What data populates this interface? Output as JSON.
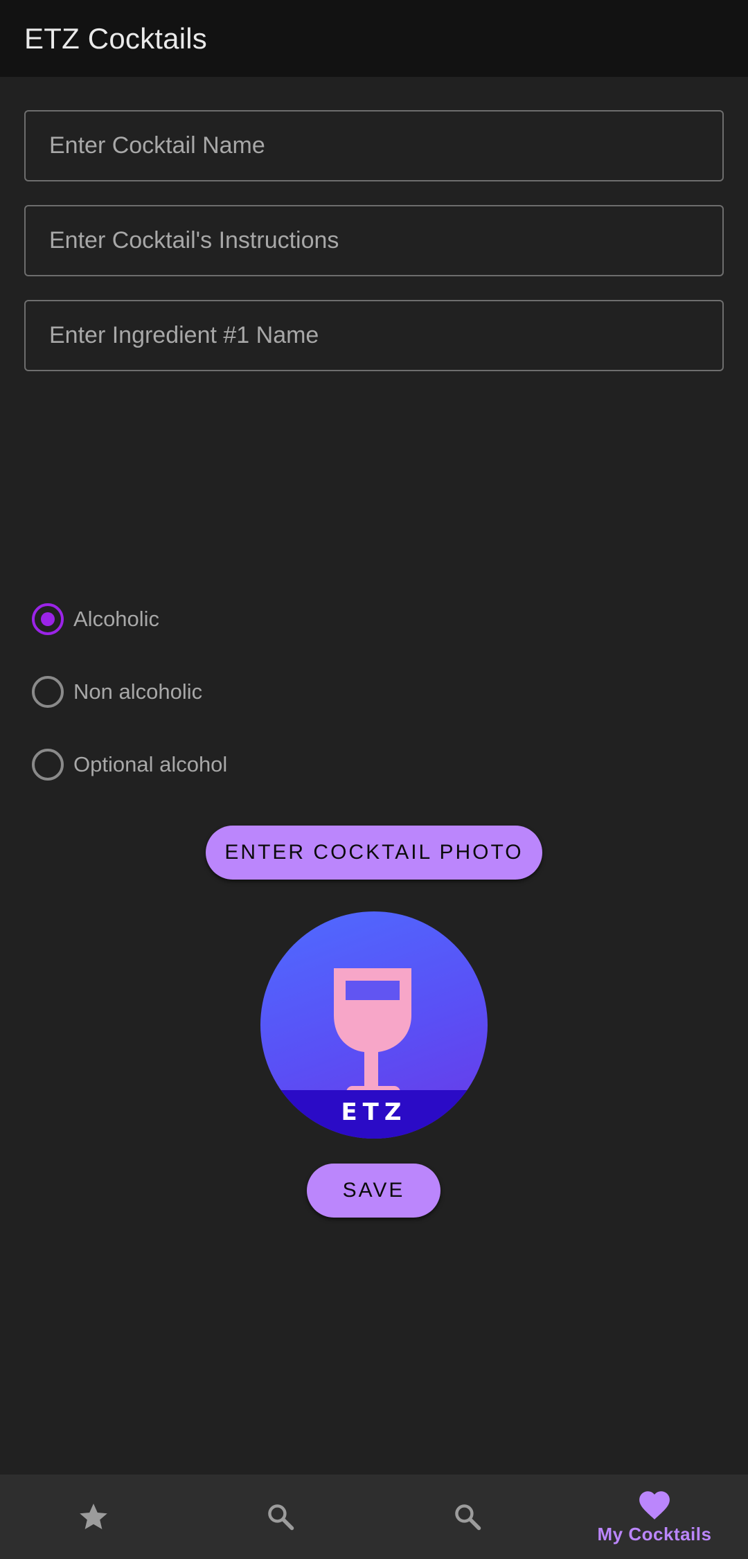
{
  "app_bar": {
    "title": "ETZ Cocktails"
  },
  "form": {
    "cocktail_name": {
      "value": "",
      "placeholder": "Enter Cocktail Name"
    },
    "instructions": {
      "value": "",
      "placeholder": "Enter Cocktail's Instructions"
    },
    "ingredient_1": {
      "value": "",
      "placeholder": "Enter Ingredient #1 Name"
    }
  },
  "alcohol_options": [
    {
      "label": "Alcoholic",
      "checked": true
    },
    {
      "label": "Non alcoholic",
      "checked": false
    },
    {
      "label": "Optional alcohol",
      "checked": false
    }
  ],
  "buttons": {
    "photo_label": "ENTER COCKTAIL PHOTO",
    "save_label": "SAVE"
  },
  "photo": {
    "logo_text": "ETZ",
    "icon": "wine-glass-icon"
  },
  "bottom_nav": {
    "items": [
      {
        "icon": "star-icon",
        "label": "",
        "active": false
      },
      {
        "icon": "search-icon",
        "label": "",
        "active": false
      },
      {
        "icon": "search-icon",
        "label": "",
        "active": false
      },
      {
        "icon": "heart-icon",
        "label": "My Cocktails",
        "active": true
      }
    ]
  },
  "colors": {
    "accent": "#bb86fc",
    "radio_checked": "#9b24e8",
    "background": "#212121",
    "app_bar": "#121212",
    "bottom_nav": "#2e2e2e"
  }
}
